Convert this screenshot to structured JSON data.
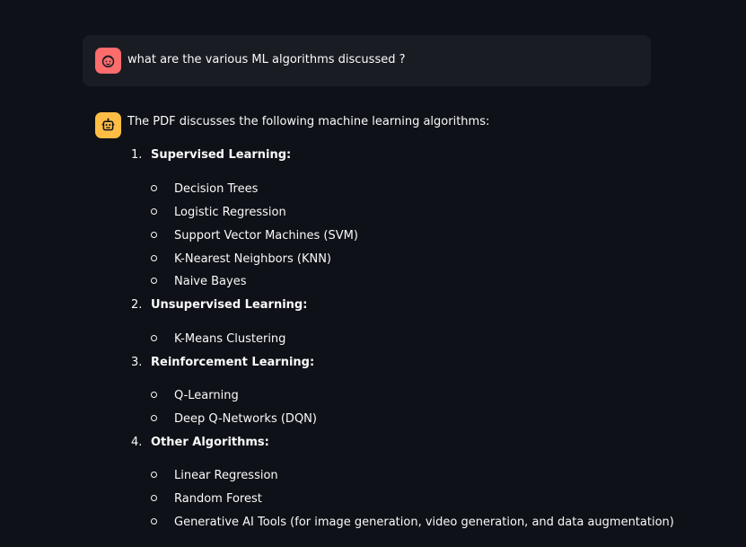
{
  "user_message": {
    "avatar_icon": "user-face-icon",
    "text": "what are the various ML algorithms discussed ?"
  },
  "assistant_message": {
    "avatar_icon": "robot-icon",
    "intro": "The PDF discusses the following machine learning algorithms:",
    "sections": [
      {
        "number": "1.",
        "title": "Supervised Learning:",
        "items": [
          "Decision Trees",
          "Logistic Regression",
          "Support Vector Machines (SVM)",
          "K-Nearest Neighbors (KNN)",
          "Naive Bayes"
        ]
      },
      {
        "number": "2.",
        "title": "Unsupervised Learning:",
        "items": [
          "K-Means Clustering"
        ]
      },
      {
        "number": "3.",
        "title": "Reinforcement Learning:",
        "items": [
          "Q-Learning",
          "Deep Q-Networks (DQN)"
        ]
      },
      {
        "number": "4.",
        "title": "Other Algorithms:",
        "items": [
          "Linear Regression",
          "Random Forest",
          "Generative AI Tools (for image generation, video generation, and data augmentation)"
        ]
      }
    ]
  },
  "colors": {
    "background": "#0e1117",
    "user_bubble": "#1a1c24",
    "user_avatar": "#ff6c6c",
    "bot_avatar": "#ffbd45",
    "text": "#fafafa"
  }
}
